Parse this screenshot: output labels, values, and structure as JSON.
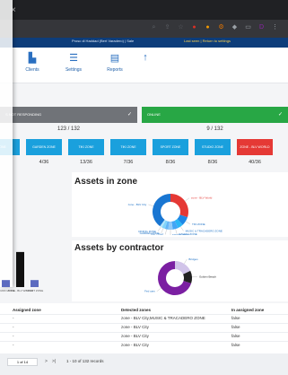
{
  "browser": {
    "tab_close_glyph": "×",
    "extension_icons": [
      {
        "name": "zoom-icon",
        "glyph": "⌕",
        "color": "#5f6368"
      },
      {
        "name": "share-icon",
        "glyph": "⇪",
        "color": "#5f6368"
      },
      {
        "name": "star-icon",
        "glyph": "☆",
        "color": "#5f6368"
      },
      {
        "name": "ext-red-icon",
        "glyph": "●",
        "color": "#d93025"
      },
      {
        "name": "ext-orange-icon",
        "glyph": "●",
        "color": "#f29900"
      },
      {
        "name": "ext-gear-icon",
        "glyph": "⚙",
        "color": "#e37400"
      },
      {
        "name": "ext-puzzle-icon",
        "glyph": "◆",
        "color": "#9aa0a6"
      },
      {
        "name": "window-icon",
        "glyph": "▭",
        "color": "#9aa0a6"
      },
      {
        "name": "profile-icon",
        "glyph": "D",
        "color": "#8e24aa"
      },
      {
        "name": "menu-icon",
        "glyph": "⋮",
        "color": "#9aa0a6"
      }
    ]
  },
  "app": {
    "topbar_text": "Prosc di Haddad (Bert Varadero) | Sale",
    "topbar_link": "Last seen | Return to settings",
    "menu": [
      {
        "label": "Clients",
        "icon": "clients-icon",
        "glyph": "▙"
      },
      {
        "label": "Settings",
        "icon": "settings-icon",
        "glyph": "☰"
      },
      {
        "label": "Reports",
        "icon": "reports-icon",
        "glyph": "▤"
      },
      {
        "label": "",
        "icon": "up-arrow-icon",
        "glyph": "↑"
      }
    ]
  },
  "status": {
    "grey_label": "S NOT RESPONDING",
    "green_label": "ONLINE",
    "grey_count": "123 / 132",
    "green_count": "9 / 132"
  },
  "zones": [
    {
      "label": "ZONE",
      "value": ""
    },
    {
      "label": "GARDEN ZONE",
      "value": "4/36"
    },
    {
      "label": "TIKI ZONE",
      "value": "13/36"
    },
    {
      "label": "TIKI ZONE",
      "value": "7/36"
    },
    {
      "label": "SPORT ZONE",
      "value": "8/36"
    },
    {
      "label": "STUDIO ZONE",
      "value": "8/36"
    },
    {
      "label": "ZONE - BLV WORLD",
      "value": "40/36"
    }
  ],
  "charts": {
    "assets_in_zone_title": "Assets in zone",
    "assets_by_contractor_title": "Assets by contractor"
  },
  "chart_data": [
    {
      "type": "pie",
      "title": "Assets in zone",
      "labels": [
        "zone - BLV World",
        "TIKI ZONE",
        "MUSIC & TRACADERO ZONE",
        "STUDIO ZONE",
        "SPORT ZONE",
        "TIKI ZONE",
        "GARDEN ZONE",
        "DINING ZONE",
        "zone - BLV City"
      ],
      "values": [
        30,
        8,
        5,
        5,
        4,
        3,
        3,
        2,
        40
      ],
      "colors": [
        "#e53935",
        "#1e88e5",
        "#29b6f6",
        "#42a5f5",
        "#90caf9",
        "#64b5f6",
        "#81d4fa",
        "#b3e5fc",
        "#1976d2"
      ]
    },
    {
      "type": "pie",
      "title": "Assets by contractor",
      "labels": [
        "Bridges",
        "Golden Beach",
        "Fed cars"
      ],
      "values": [
        18,
        12,
        70
      ],
      "colors": [
        "#d1c4e9",
        "#212121",
        "#7b1fa2"
      ]
    },
    {
      "type": "bar",
      "categories": [
        "STUDIO ZONE",
        "ZONE - BLV WORLD",
        "SPORT ZONE"
      ],
      "values": [
        8,
        40,
        8
      ],
      "ylim": [
        0,
        45
      ]
    }
  ],
  "table": {
    "headers": [
      "Assigned zone",
      "Detected zones",
      "In assigned zone"
    ],
    "rows": [
      [
        "-",
        "zone - BLV City,MUSIC & TRACADERO ZONE",
        "false"
      ],
      [
        "-",
        "zone - BLV City",
        "false"
      ],
      [
        "-",
        "zone - BLV City",
        "false"
      ],
      [
        "-",
        "zone - BLV City",
        "false"
      ]
    ]
  },
  "pager": {
    "page": "1 of 14",
    "summary": "1 - 10 of 132 records",
    "next": ">",
    "last": ">|"
  }
}
